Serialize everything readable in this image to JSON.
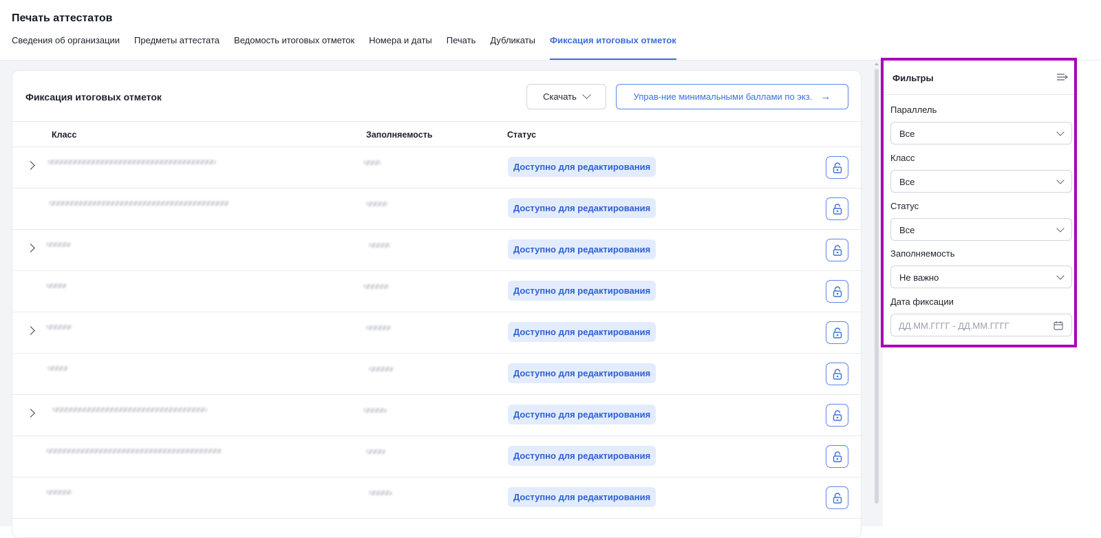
{
  "header": {
    "title": "Печать аттестатов",
    "tabs": [
      {
        "label": "Сведения об организации",
        "active": false
      },
      {
        "label": "Предметы аттестата",
        "active": false
      },
      {
        "label": "Ведомость итоговых отметок",
        "active": false
      },
      {
        "label": "Номера и даты",
        "active": false
      },
      {
        "label": "Печать",
        "active": false
      },
      {
        "label": "Дубликаты",
        "active": false
      },
      {
        "label": "Фиксация итоговых отметок",
        "active": true
      }
    ]
  },
  "card": {
    "title": "Фиксация итоговых отметок",
    "download_label": "Скачать",
    "manage_label": "Управ-ние минимальными баллами по экз.",
    "columns": {
      "class": "Класс",
      "fill": "Заполняемость",
      "status": "Статус"
    },
    "rows": [
      {
        "expandable": true,
        "status": "Доступно для редактирования"
      },
      {
        "expandable": false,
        "status": "Доступно для редактирования"
      },
      {
        "expandable": true,
        "status": "Доступно для редактирования"
      },
      {
        "expandable": false,
        "status": "Доступно для редактирования"
      },
      {
        "expandable": true,
        "status": "Доступно для редактирования"
      },
      {
        "expandable": false,
        "status": "Доступно для редактирования"
      },
      {
        "expandable": true,
        "status": "Доступно для редактирования"
      },
      {
        "expandable": false,
        "status": "Доступно для редактирования"
      },
      {
        "expandable": false,
        "status": "Доступно для редактирования"
      }
    ]
  },
  "filters": {
    "title": "Фильтры",
    "parallel": {
      "label": "Параллель",
      "value": "Все"
    },
    "class": {
      "label": "Класс",
      "value": "Все"
    },
    "status": {
      "label": "Статус",
      "value": "Все"
    },
    "fill": {
      "label": "Заполняемость",
      "value": "Не важно"
    },
    "date": {
      "label": "Дата фиксации",
      "placeholder": "ДД.ММ.ГГГГ - ДД.ММ.ГГГГ"
    }
  },
  "colors": {
    "accent": "#3d6ee0",
    "highlight_border": "#a600b4",
    "status_bg": "#e3ecfd"
  }
}
